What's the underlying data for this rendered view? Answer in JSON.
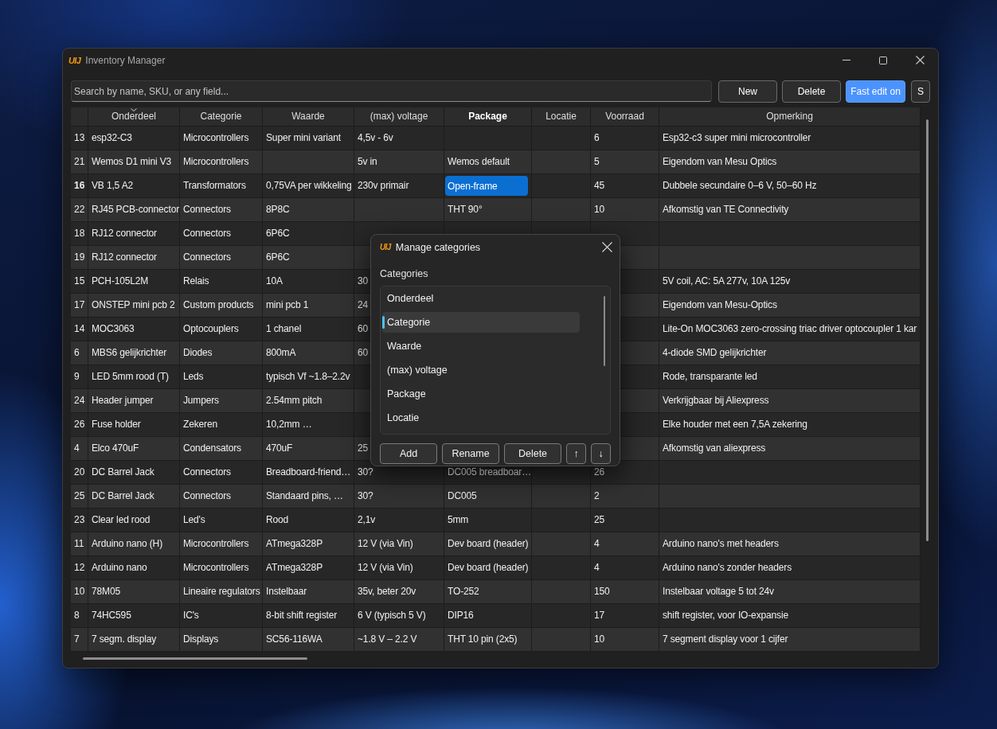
{
  "window": {
    "logo": "UIJ",
    "title": "Inventory Manager"
  },
  "toolbar": {
    "search": {
      "placeholder": "Search by name, SKU, or any field..."
    },
    "buttons": [
      {
        "label": "New",
        "kind": "action"
      },
      {
        "label": "Delete",
        "kind": "action"
      },
      {
        "label": "Fast edit on",
        "kind": "toggle",
        "on": true
      },
      {
        "label": "S",
        "kind": "action"
      }
    ]
  },
  "table": {
    "columns": [
      {
        "label": "Onderdeel",
        "sorted": true,
        "selected": false
      },
      {
        "label": "Categorie",
        "sorted": false,
        "selected": false
      },
      {
        "label": "Waarde",
        "sorted": false,
        "selected": false
      },
      {
        "label": "(max) voltage",
        "sorted": false,
        "selected": false
      },
      {
        "label": "Package",
        "sorted": false,
        "selected": true
      },
      {
        "label": "Locatie",
        "sorted": false,
        "selected": false
      },
      {
        "label": "Voorraad",
        "sorted": false,
        "selected": false
      },
      {
        "label": "Opmerking",
        "sorted": false,
        "selected": false
      }
    ],
    "rows": [
      {
        "id": "13",
        "selected": false,
        "onderdeel": "esp32-C3",
        "categorie": "Microcontrollers",
        "waarde": "Super mini variant",
        "max_voltage": "4,5v - 6v",
        "voorraad": "6",
        "opmerking": "Esp32-c3 super mini microcontroller"
      },
      {
        "id": "21",
        "selected": false,
        "onderdeel": "Wemos D1 mini V3",
        "categorie": "Microcontrollers",
        "max_voltage": "5v in",
        "package": "Wemos default",
        "voorraad": "5",
        "opmerking": "Eigendom van Mesu Optics"
      },
      {
        "id": "16",
        "selected": true,
        "onderdeel": "VB 1,5 A2",
        "categorie": "Transformators",
        "waarde": "0,75VA per wikkeling",
        "max_voltage": "230v primair",
        "package": "Open-frame",
        "voorraad": "45",
        "opmerking": "Dubbele secundaire 0–6 V, 50–60 Hz"
      },
      {
        "id": "22",
        "selected": false,
        "onderdeel": "RJ45 PCB-connector",
        "categorie": "Connectors",
        "waarde": "8P8C",
        "package": "THT 90°",
        "voorraad": "10",
        "opmerking": "Afkomstig van TE Connectivity"
      },
      {
        "id": "18",
        "selected": false,
        "onderdeel": "RJ12 connector",
        "categorie": "Connectors",
        "waarde": "6P6C"
      },
      {
        "id": "19",
        "selected": false,
        "onderdeel": "RJ12 connector",
        "categorie": "Connectors",
        "waarde": "6P6C"
      },
      {
        "id": "15",
        "selected": false,
        "onderdeel": "PCH-105L2M",
        "categorie": "Relais",
        "waarde": "10A",
        "max_voltage": "30",
        "opmerking": "5V coil, AC: 5A 277v, 10A 125v"
      },
      {
        "id": "17",
        "selected": false,
        "onderdeel": "ONSTEP mini pcb 2",
        "categorie": "Custom products",
        "waarde": "mini pcb 1",
        "max_voltage": "24",
        "opmerking": "Eigendom van Mesu-Optics"
      },
      {
        "id": "14",
        "selected": false,
        "onderdeel": "MOC3063",
        "categorie": "Optocouplers",
        "waarde": "1 chanel",
        "max_voltage": "60",
        "opmerking": "Lite-On MOC3063 zero-crossing triac driver optocoupler 1 kar"
      },
      {
        "id": "6",
        "selected": false,
        "onderdeel": "MBS6 gelijkrichter",
        "categorie": "Diodes",
        "waarde": "800mA",
        "max_voltage": "60",
        "opmerking": "4-diode SMD gelijkrichter"
      },
      {
        "id": "9",
        "selected": false,
        "onderdeel": "LED 5mm rood (T)",
        "categorie": "Leds",
        "waarde": "typisch Vf ~1.8–2.2v",
        "opmerking": "Rode, transparante led"
      },
      {
        "id": "24",
        "selected": false,
        "onderdeel": "Header jumper",
        "categorie": "Jumpers",
        "waarde": "2.54mm pitch",
        "opmerking": "Verkrijgbaar bij Aliexpress"
      },
      {
        "id": "26",
        "selected": false,
        "onderdeel": "Fuse holder",
        "categorie": "Zekeren",
        "waarde": "10,2mm …",
        "opmerking": "Elke houder met een 7,5A zekering"
      },
      {
        "id": "4",
        "selected": false,
        "onderdeel": "Elco 470uF",
        "categorie": "Condensators",
        "waarde": "470uF",
        "max_voltage": "25",
        "opmerking": "Afkomstig van aliexpress"
      },
      {
        "id": "20",
        "selected": false,
        "onderdeel": "DC Barrel Jack",
        "categorie": "Connectors",
        "waarde": "Breadboard-friend…",
        "max_voltage": "30?",
        "package": "DC005 breadboar…",
        "voorraad": "26"
      },
      {
        "id": "25",
        "selected": false,
        "onderdeel": "DC Barrel Jack",
        "categorie": "Connectors",
        "waarde": "Standaard pins, …",
        "max_voltage": "30?",
        "package": "DC005",
        "voorraad": "2"
      },
      {
        "id": "23",
        "selected": false,
        "onderdeel": "Clear led rood",
        "categorie": "Led's",
        "waarde": "Rood",
        "max_voltage": "2,1v",
        "package": "5mm",
        "voorraad": "25"
      },
      {
        "id": "11",
        "selected": false,
        "onderdeel": "Arduino nano (H)",
        "categorie": "Microcontrollers",
        "waarde": "ATmega328P",
        "max_voltage": "12 V (via Vin)",
        "package": "Dev board (header)",
        "voorraad": "4",
        "opmerking": "Arduino nano's met headers"
      },
      {
        "id": "12",
        "selected": false,
        "onderdeel": "Arduino nano",
        "categorie": "Microcontrollers",
        "waarde": "ATmega328P",
        "max_voltage": "12 V (via Vin)",
        "package": "Dev board (header)",
        "voorraad": "4",
        "opmerking": "Arduino nano's zonder headers"
      },
      {
        "id": "10",
        "selected": false,
        "onderdeel": "78M05",
        "categorie": "Lineaire regulators",
        "waarde": "Instelbaar",
        "max_voltage": "35v, beter 20v",
        "package": "TO-252",
        "voorraad": "150",
        "opmerking": "Instelbaar voltage 5 tot 24v"
      },
      {
        "id": "8",
        "selected": false,
        "onderdeel": "74HC595",
        "categorie": "IC's",
        "waarde": "8-bit shift register",
        "max_voltage": "6 V (typisch 5 V)",
        "package": "DIP16",
        "voorraad": "17",
        "opmerking": "shift register, voor IO-expansie"
      },
      {
        "id": "7",
        "selected": false,
        "onderdeel": "7 segm. display",
        "categorie": "Displays",
        "waarde": "SC56-116WA",
        "max_voltage": "~1.8 V – 2.2 V",
        "package": "THT 10 pin (2x5)",
        "voorraad": "10",
        "opmerking": "7 segment display voor 1 cijfer"
      }
    ]
  },
  "dialog": {
    "logo": "UIJ",
    "title": "Manage categories",
    "label": "Categories",
    "items": [
      {
        "label": "Onderdeel",
        "selected": false
      },
      {
        "label": "Categorie",
        "selected": true
      },
      {
        "label": "Waarde",
        "selected": false
      },
      {
        "label": "(max) voltage",
        "selected": false
      },
      {
        "label": "Package",
        "selected": false
      },
      {
        "label": "Locatie",
        "selected": false
      }
    ],
    "buttons": [
      {
        "label": "Add",
        "kind": "text"
      },
      {
        "label": "Rename",
        "kind": "text"
      },
      {
        "label": "Delete",
        "kind": "text"
      },
      {
        "label": "↑",
        "kind": "arrow"
      },
      {
        "label": "↓",
        "kind": "arrow"
      }
    ]
  }
}
